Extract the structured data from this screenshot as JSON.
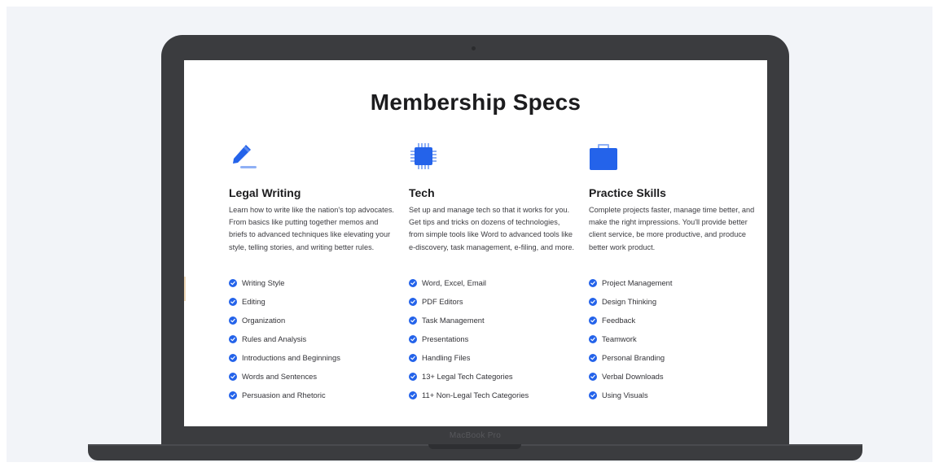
{
  "page": {
    "title": "Membership Specs",
    "device_label": "MacBook Pro"
  },
  "colors": {
    "accent": "#2463ea",
    "accent_light": "#8fb0f5",
    "device": "#3b3c3f",
    "background": "#f2f4f8"
  },
  "columns": [
    {
      "icon": "pencil-icon",
      "title": "Legal Writing",
      "description": "Learn how to write like the nation's top advocates. From basics like putting together memos and briefs to advanced techniques like elevating your style, telling stories, and writing better rules.",
      "items": [
        "Writing Style",
        "Editing",
        "Organization",
        "Rules and Analysis",
        "Introductions and Beginnings",
        "Words and Sentences",
        "Persuasion and Rhetoric"
      ]
    },
    {
      "icon": "chip-icon",
      "title": "Tech",
      "description": "Set up and manage tech so that it works for you. Get tips and tricks on dozens of technologies, from simple tools like Word to advanced tools like e-discovery, task management, e-filing, and more.",
      "items": [
        "Word, Excel, Email",
        "PDF Editors",
        "Task Management",
        "Presentations",
        "Handling Files",
        "13+ Legal Tech Categories",
        "11+ Non-Legal Tech Categories"
      ]
    },
    {
      "icon": "briefcase-icon",
      "title": "Practice Skills",
      "description": "Complete projects faster, manage time better, and make the right impressions. You'll provide better client service, be more productive, and produce better work product.",
      "items": [
        "Project Management",
        "Design Thinking",
        "Feedback",
        "Teamwork",
        "Personal Branding",
        "Verbal Downloads",
        "Using Visuals"
      ]
    }
  ]
}
